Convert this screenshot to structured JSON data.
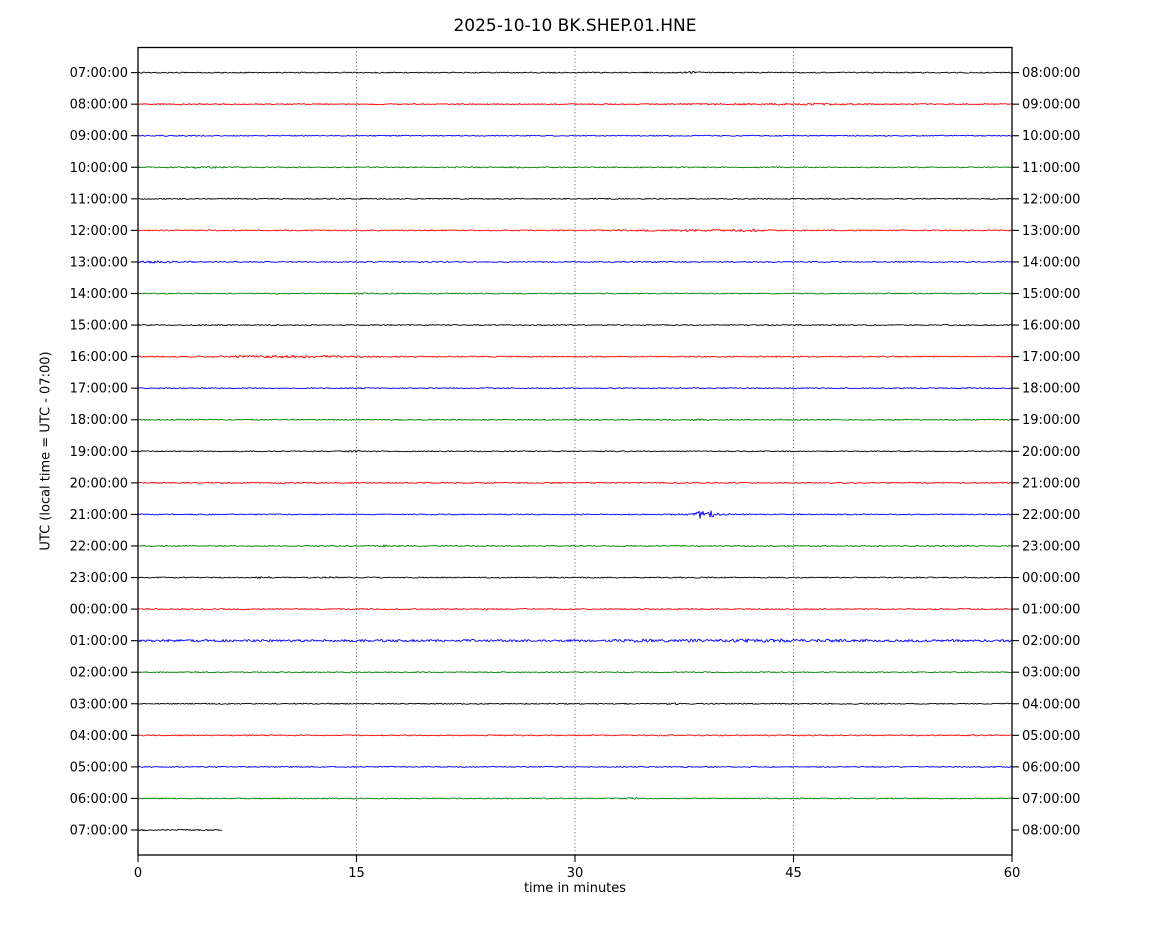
{
  "chart_data": {
    "type": "line",
    "subtype": "seismogram-helicorder-dayplot",
    "title": "2025-10-10 BK.SHEP.01.HNE",
    "xlabel": "time in minutes",
    "ylabel": "UTC (local time = UTC - 07:00)",
    "xlim": [
      0,
      60
    ],
    "x_ticks": [
      0,
      15,
      30,
      45,
      60
    ],
    "grid": "vertical dotted lines at 15, 30, 45 minutes",
    "legend": "none",
    "trace_colors_cycle": [
      "#000000",
      "#ff0000",
      "#0000ff",
      "#008000"
    ],
    "frame_color": "#000000",
    "background_color": "#ffffff",
    "minutes_per_row": 60,
    "rows": [
      {
        "left_label": "07:00:00",
        "right_label": "08:00:00",
        "color": "#000000",
        "duration_min": 60,
        "base_amp": 0.55,
        "events": [
          {
            "minute": 38,
            "amp": 0.7,
            "width_min": 0.4
          }
        ]
      },
      {
        "left_label": "08:00:00",
        "right_label": "09:00:00",
        "color": "#ff0000",
        "duration_min": 60,
        "base_amp": 0.6,
        "events": [
          {
            "minute": 42.5,
            "amp": 0.35,
            "width_min": 3
          },
          {
            "minute": 47,
            "amp": 0.3,
            "width_min": 2
          }
        ]
      },
      {
        "left_label": "09:00:00",
        "right_label": "10:00:00",
        "color": "#0000ff",
        "duration_min": 60,
        "base_amp": 0.55,
        "events": []
      },
      {
        "left_label": "10:00:00",
        "right_label": "11:00:00",
        "color": "#008000",
        "duration_min": 60,
        "base_amp": 0.55,
        "events": [
          {
            "minute": 4.5,
            "amp": 0.4,
            "width_min": 1.5
          },
          {
            "minute": 26,
            "amp": 0.5,
            "width_min": 0.4
          }
        ]
      },
      {
        "left_label": "11:00:00",
        "right_label": "12:00:00",
        "color": "#000000",
        "duration_min": 60,
        "base_amp": 0.55,
        "events": []
      },
      {
        "left_label": "12:00:00",
        "right_label": "13:00:00",
        "color": "#ff0000",
        "duration_min": 60,
        "base_amp": 0.6,
        "events": [
          {
            "minute": 38,
            "amp": 0.45,
            "width_min": 3.5
          },
          {
            "minute": 42,
            "amp": 0.8,
            "width_min": 0.5
          }
        ]
      },
      {
        "left_label": "13:00:00",
        "right_label": "14:00:00",
        "color": "#0000ff",
        "duration_min": 60,
        "base_amp": 0.55,
        "events": [
          {
            "minute": 1.5,
            "amp": 0.7,
            "width_min": 1.5
          }
        ]
      },
      {
        "left_label": "14:00:00",
        "right_label": "15:00:00",
        "color": "#008000",
        "duration_min": 60,
        "base_amp": 0.55,
        "events": [
          {
            "minute": 15,
            "amp": 0.4,
            "width_min": 0.4
          }
        ]
      },
      {
        "left_label": "15:00:00",
        "right_label": "16:00:00",
        "color": "#000000",
        "duration_min": 60,
        "base_amp": 0.55,
        "events": []
      },
      {
        "left_label": "16:00:00",
        "right_label": "17:00:00",
        "color": "#ff0000",
        "duration_min": 60,
        "base_amp": 0.6,
        "events": [
          {
            "minute": 9,
            "amp": 0.55,
            "width_min": 2.5
          },
          {
            "minute": 13,
            "amp": 0.5,
            "width_min": 2
          }
        ]
      },
      {
        "left_label": "17:00:00",
        "right_label": "18:00:00",
        "color": "#0000ff",
        "duration_min": 60,
        "base_amp": 0.55,
        "events": []
      },
      {
        "left_label": "18:00:00",
        "right_label": "19:00:00",
        "color": "#008000",
        "duration_min": 60,
        "base_amp": 0.55,
        "events": [
          {
            "minute": 38.5,
            "amp": 0.5,
            "width_min": 0.4
          }
        ]
      },
      {
        "left_label": "19:00:00",
        "right_label": "20:00:00",
        "color": "#000000",
        "duration_min": 60,
        "base_amp": 0.55,
        "events": [
          {
            "minute": 14.7,
            "amp": 0.6,
            "width_min": 0.35
          }
        ]
      },
      {
        "left_label": "20:00:00",
        "right_label": "21:00:00",
        "color": "#ff0000",
        "duration_min": 60,
        "base_amp": 0.6,
        "events": []
      },
      {
        "left_label": "21:00:00",
        "right_label": "22:00:00",
        "color": "#0000ff",
        "duration_min": 60,
        "base_amp": 0.55,
        "events": [
          {
            "minute": 38.6,
            "amp": 3.2,
            "width_min": 0.18
          },
          {
            "minute": 39.4,
            "amp": 3.0,
            "width_min": 0.18
          },
          {
            "minute": 39,
            "amp": 0.7,
            "width_min": 1.3
          }
        ]
      },
      {
        "left_label": "22:00:00",
        "right_label": "23:00:00",
        "color": "#008000",
        "duration_min": 60,
        "base_amp": 0.55,
        "events": [
          {
            "minute": 17,
            "amp": 1.4,
            "width_min": 0.12
          },
          {
            "minute": 17.8,
            "amp": 1.6,
            "width_min": 0.15
          }
        ]
      },
      {
        "left_label": "23:00:00",
        "right_label": "00:00:00",
        "color": "#000000",
        "duration_min": 60,
        "base_amp": 0.55,
        "events": [
          {
            "minute": 8.7,
            "amp": 0.6,
            "width_min": 0.35
          },
          {
            "minute": 13.3,
            "amp": 0.55,
            "width_min": 0.35
          }
        ]
      },
      {
        "left_label": "00:00:00",
        "right_label": "01:00:00",
        "color": "#ff0000",
        "duration_min": 60,
        "base_amp": 0.6,
        "events": []
      },
      {
        "left_label": "01:00:00",
        "right_label": "02:00:00",
        "color": "#0000ff",
        "duration_min": 60,
        "base_amp": 1.2,
        "events": [
          {
            "minute": 34.5,
            "amp": 0.5,
            "width_min": 1
          },
          {
            "minute": 38,
            "amp": 0.5,
            "width_min": 1
          },
          {
            "minute": 42,
            "amp": 0.6,
            "width_min": 1
          },
          {
            "minute": 44,
            "amp": 0.5,
            "width_min": 0.8
          },
          {
            "minute": 47.5,
            "amp": 0.7,
            "width_min": 0.5
          }
        ]
      },
      {
        "left_label": "02:00:00",
        "right_label": "03:00:00",
        "color": "#008000",
        "duration_min": 60,
        "base_amp": 0.55,
        "events": []
      },
      {
        "left_label": "03:00:00",
        "right_label": "04:00:00",
        "color": "#000000",
        "duration_min": 60,
        "base_amp": 0.55,
        "events": [
          {
            "minute": 36.9,
            "amp": 0.9,
            "width_min": 0.25
          }
        ]
      },
      {
        "left_label": "04:00:00",
        "right_label": "05:00:00",
        "color": "#ff0000",
        "duration_min": 60,
        "base_amp": 0.6,
        "events": []
      },
      {
        "left_label": "05:00:00",
        "right_label": "06:00:00",
        "color": "#0000ff",
        "duration_min": 60,
        "base_amp": 0.55,
        "events": []
      },
      {
        "left_label": "06:00:00",
        "right_label": "07:00:00",
        "color": "#008000",
        "duration_min": 60,
        "base_amp": 0.55,
        "events": [
          {
            "minute": 34,
            "amp": 0.45,
            "width_min": 0.5
          }
        ]
      },
      {
        "left_label": "07:00:00",
        "right_label": "08:00:00",
        "color": "#000000",
        "duration_min": 5.8,
        "base_amp": 0.7,
        "events": []
      }
    ]
  }
}
